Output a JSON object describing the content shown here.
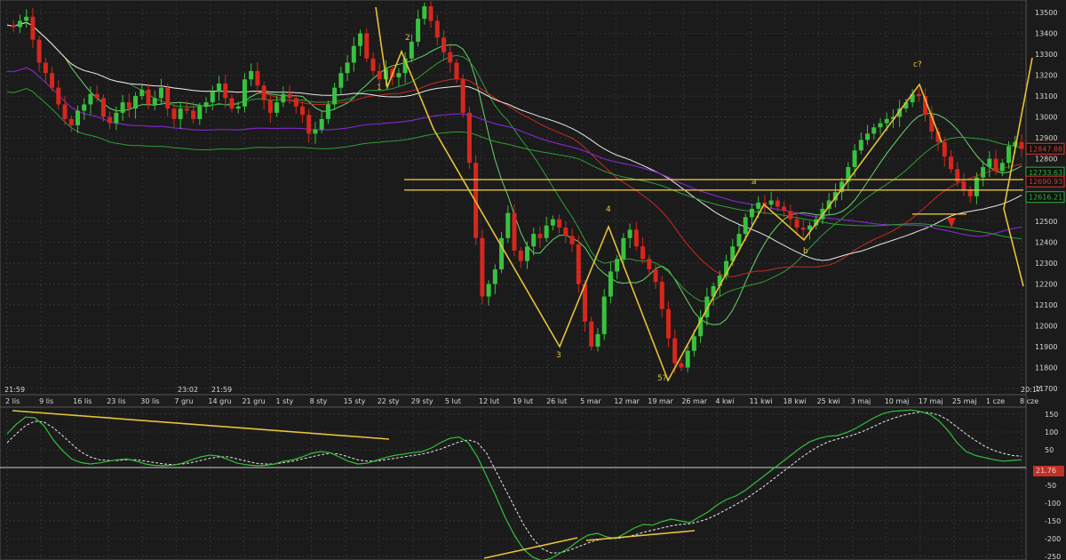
{
  "chart_data": [
    {
      "type": "candlestick",
      "y_ticks": [
        13500,
        13400,
        13300,
        13200,
        13100,
        13000,
        12900,
        12800,
        12500,
        12400,
        12300,
        12200,
        12100,
        12000,
        11900,
        11800,
        11700
      ],
      "ylim": [
        11670,
        13560
      ],
      "x_labels": [
        "2 lis",
        "9 lis",
        "16 lis",
        "23 lis",
        "30 lis",
        "7 gru",
        "14 gru",
        "21 gru",
        "1 sty",
        "8 sty",
        "15 sty",
        "22 sty",
        "29 sty",
        "5 lut",
        "12 lut",
        "19 lut",
        "26 lut",
        "5 mar",
        "12 mar",
        "19 mar",
        "26 mar",
        "4 kwi",
        "11 kwi",
        "18 kwi",
        "25 kwi",
        "3 maj",
        "10 maj",
        "17 maj",
        "25 maj",
        "1 cze",
        "8 cze"
      ],
      "time_stamps": [
        "21:59",
        "23:02",
        "21:59",
        "20:17"
      ],
      "price_labels": [
        {
          "value": 12847.88,
          "text": "12847.88",
          "color": "#d83a2f"
        },
        {
          "value": 12733.63,
          "text": "12733.63",
          "color": "#31b43c"
        },
        {
          "value": 12690.93,
          "text": "12690.93",
          "color": "#d83a2f"
        },
        {
          "value": 12616.21,
          "text": "12616.21",
          "color": "#31b43c"
        }
      ],
      "wave_labels": [
        "1",
        "2",
        "3",
        "4",
        "5?",
        "a",
        "b",
        "c?"
      ]
    },
    {
      "type": "line",
      "y_ticks": [
        150,
        100,
        50,
        -50,
        -100,
        -150,
        -200,
        -250
      ],
      "ylim": [
        -260,
        170
      ],
      "value_label": "21.76",
      "series": [
        {
          "values": [
            95,
            122,
            142,
            140,
            118,
            78,
            48,
            24,
            14,
            10,
            13,
            18,
            22,
            24,
            18,
            10,
            6,
            5,
            7,
            12,
            22,
            30,
            35,
            32,
            22,
            12,
            8,
            5,
            6,
            10,
            18,
            22,
            30,
            40,
            45,
            42,
            30,
            18,
            10,
            12,
            20,
            28,
            34,
            38,
            42,
            45,
            55,
            70,
            82,
            86,
            70,
            30,
            -25,
            -80,
            -140,
            -190,
            -230,
            -252,
            -262,
            -255,
            -240,
            -225,
            -205,
            -190,
            -185,
            -195,
            -200,
            -185,
            -170,
            -160,
            -162,
            -152,
            -145,
            -150,
            -155,
            -140,
            -125,
            -105,
            -90,
            -80,
            -65,
            -45,
            -25,
            -5,
            15,
            35,
            55,
            72,
            82,
            88,
            90,
            98,
            110,
            125,
            140,
            152,
            158,
            160,
            162,
            158,
            150,
            132,
            105,
            70,
            45,
            34,
            28,
            22,
            18,
            20,
            22
          ]
        },
        {
          "values": [
            70,
            95,
            118,
            130,
            128,
            112,
            90,
            66,
            44,
            30,
            22,
            20,
            20,
            22,
            22,
            18,
            14,
            10,
            8,
            10,
            14,
            20,
            26,
            30,
            30,
            24,
            18,
            12,
            10,
            10,
            14,
            18,
            24,
            30,
            36,
            40,
            38,
            30,
            22,
            18,
            18,
            22,
            26,
            30,
            34,
            38,
            44,
            52,
            62,
            72,
            78,
            70,
            40,
            -10,
            -60,
            -110,
            -160,
            -200,
            -228,
            -240,
            -240,
            -232,
            -222,
            -212,
            -204,
            -200,
            -200,
            -196,
            -190,
            -182,
            -176,
            -170,
            -164,
            -160,
            -158,
            -152,
            -144,
            -132,
            -118,
            -104,
            -90,
            -72,
            -54,
            -34,
            -14,
            6,
            26,
            44,
            60,
            72,
            80,
            86,
            94,
            104,
            116,
            128,
            138,
            146,
            152,
            156,
            154,
            148,
            134,
            114,
            94,
            76,
            60,
            48,
            40,
            34,
            32
          ]
        }
      ]
    }
  ],
  "colors": {
    "background": "#1b1b1b",
    "up": "#38c23f",
    "down": "#d6271e",
    "wave": "#e6c23a",
    "ma_white": "#e8e8e8",
    "ma_red": "#c82a23",
    "ma_purple": "#7e27c6",
    "ma_green": "#2f9e36",
    "ma_green2": "#68d46e"
  }
}
